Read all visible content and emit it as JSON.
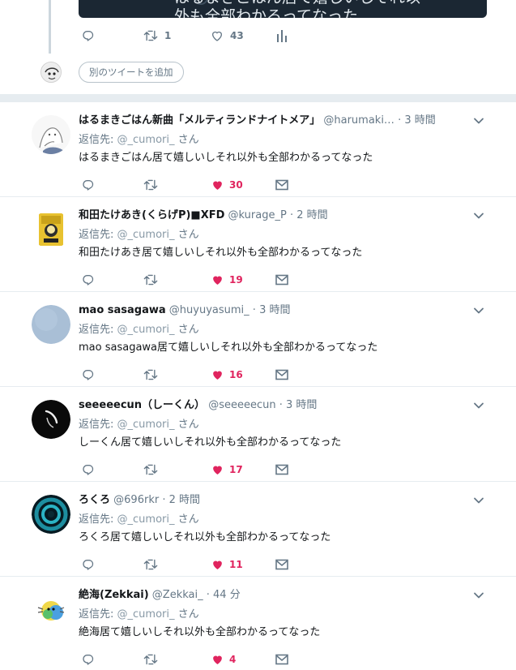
{
  "top_tweet": {
    "media_text_line1": "はるまきごはん居て嬉しいしそれ以",
    "media_text_line2": "外も全部わかるってなった",
    "retweet_count": "1",
    "like_count": "43"
  },
  "add_tweet_button": "別のツイートを追加",
  "colors": {
    "like": "#e0245e",
    "secondary_text": "#657786",
    "separator": "#e6ecf0",
    "primary_text": "#14171a"
  },
  "replies": [
    {
      "name": "はるまきごはん新曲「メルティランドナイトメア」",
      "handle": "@harumaki…",
      "time": "3 時間",
      "reply_to_label": "返信先:",
      "reply_to_mention": "@_cumori_",
      "reply_to_suffix": "さん",
      "text": "はるまきごはん居て嬉しいしそれ以外も全部わかるってなった",
      "likes": "30",
      "avatar": "sketch-avatar"
    },
    {
      "name": "和田たけあき(くらげP)■XFD",
      "handle": "@kurage_P",
      "time": "2 時間",
      "reply_to_label": "返信先:",
      "reply_to_mention": "@_cumori_",
      "reply_to_suffix": "さん",
      "text": "和田たけあき居て嬉しいしそれ以外も全部わかるってなった",
      "likes": "19",
      "avatar": "yellow-cover-avatar"
    },
    {
      "name": "mao sasagawa",
      "handle": "@huyuyasumi_",
      "time": "3 時間",
      "reply_to_label": "返信先:",
      "reply_to_mention": "@_cumori_",
      "reply_to_suffix": "さん",
      "text": "mao sasagawa居て嬉しいしそれ以外も全部わかるってなった",
      "likes": "16",
      "avatar": "blue-gray-avatar"
    },
    {
      "name": "seeeeecun（しーくん）",
      "handle": "@seeeeecun",
      "time": "3 時間",
      "reply_to_label": "返信先:",
      "reply_to_mention": "@_cumori_",
      "reply_to_suffix": "さん",
      "text": "しーくん居て嬉しいしそれ以外も全部わかるってなった",
      "likes": "17",
      "avatar": "black-avatar"
    },
    {
      "name": "ろくろ",
      "handle": "@696rkr",
      "time": "2 時間",
      "reply_to_label": "返信先:",
      "reply_to_mention": "@_cumori_",
      "reply_to_suffix": "さん",
      "text": "ろくろ居て嬉しいしそれ以外も全部わかるってなった",
      "likes": "11",
      "avatar": "swirl-avatar"
    },
    {
      "name": "絶海(Zekkai)",
      "handle": "@Zekkai_",
      "time": "44 分",
      "reply_to_label": "返信先:",
      "reply_to_mention": "@_cumori_",
      "reply_to_suffix": "さん",
      "text": "絶海居て嬉しいしそれ以外も全部わかるってなった",
      "likes": "4",
      "avatar": "character-avatar"
    }
  ]
}
